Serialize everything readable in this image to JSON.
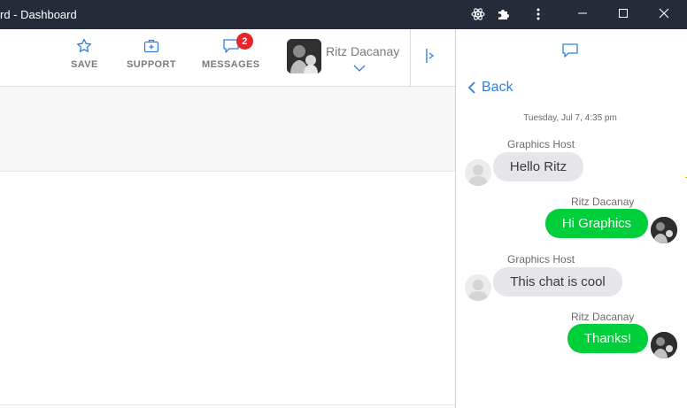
{
  "window": {
    "title": "rd - Dashboard",
    "controls": {
      "minimize": "minimize-icon",
      "maximize": "maximize-icon",
      "close": "close-icon"
    },
    "extension_icons": [
      "react-icon",
      "puzzle-icon",
      "kebab-menu-icon"
    ]
  },
  "nav": {
    "save_label": "SAVE",
    "support_label": "SUPPORT",
    "messages_label": "MESSAGES",
    "messages_badge": "2",
    "user_name": "Ritz Dacanay"
  },
  "chat": {
    "back_label": "Back",
    "date": "Tuesday, Jul 7, 4:35 pm",
    "messages": [
      {
        "sender": "Graphics Host",
        "text": "Hello Ritz",
        "direction": "in"
      },
      {
        "sender": "Ritz Dacanay",
        "text": "Hi Graphics",
        "direction": "out"
      },
      {
        "sender": "Graphics Host",
        "text": "This chat is cool",
        "direction": "in"
      },
      {
        "sender": "Ritz Dacanay",
        "text": "Thanks!",
        "direction": "out"
      }
    ]
  },
  "colors": {
    "titlebar": "#262b39",
    "accent": "#2f7fe0",
    "outgoing_bubble": "#00cf3c",
    "incoming_bubble": "#e6e6ea",
    "badge": "#e5252a"
  }
}
